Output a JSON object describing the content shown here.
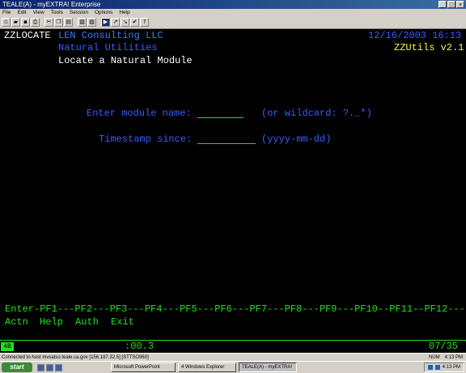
{
  "window": {
    "title": "TEALE(A) - myEXTRA! Enterprise",
    "controls": [
      "_",
      "□",
      "×"
    ]
  },
  "menu": [
    "File",
    "Edit",
    "View",
    "Tools",
    "Session",
    "Options",
    "Help"
  ],
  "toolbar_icons": [
    "new-icon",
    "open-icon",
    "save-icon",
    "print-icon",
    "cut-icon",
    "copy-icon",
    "paste-icon",
    "connect-icon",
    "disconnect-icon",
    "macro-icon",
    "send-icon",
    "receive-icon",
    "settings-icon",
    "help-icon"
  ],
  "screen": {
    "program_id": "ZZLOCATE",
    "company": "LEN Consulting LLC",
    "subtitle": "Natural Utilities",
    "function_title": "Locate a Natural Module",
    "datetime": "12/16/2003 16:13",
    "product": "ZZUtils v2.1",
    "module_label": "Enter module name:",
    "module_value": "",
    "module_hint": "(or wildcard: ?._*)",
    "timestamp_label": "Timestamp since:",
    "timestamp_value": "",
    "timestamp_hint": "(yyyy-mm-dd)",
    "pf_line": "Enter-PF1---PF2---PF3---PF4---PF5---PF6---PF7---PF8---PF9---PF10--PF11--PF12---",
    "pf_labels": {
      "enter": "Actn",
      "pf1": "Help",
      "pf2": "Auth",
      "pf3": "Exit"
    }
  },
  "oia": {
    "session": "4B",
    "timer": ":00.3",
    "cursor": "07/35"
  },
  "statusbar": {
    "connection": "Connected to host mvsatso.teale.ca.gov [156.187.32.5] [STTSO960]",
    "num": "NUM",
    "time": "4:13 PM"
  },
  "taskbar": {
    "start": "start",
    "tasks": [
      "Microsoft PowerPoint",
      "4 Windows Explorer",
      "TEALE(A) - myEXTRA!"
    ],
    "clock": "4:13 PM"
  },
  "colors": {
    "white": "#ffffff",
    "cyan": "#3a7cf8",
    "blue": "#3a5cff",
    "yellow": "#f8f840",
    "green": "#20e020"
  }
}
